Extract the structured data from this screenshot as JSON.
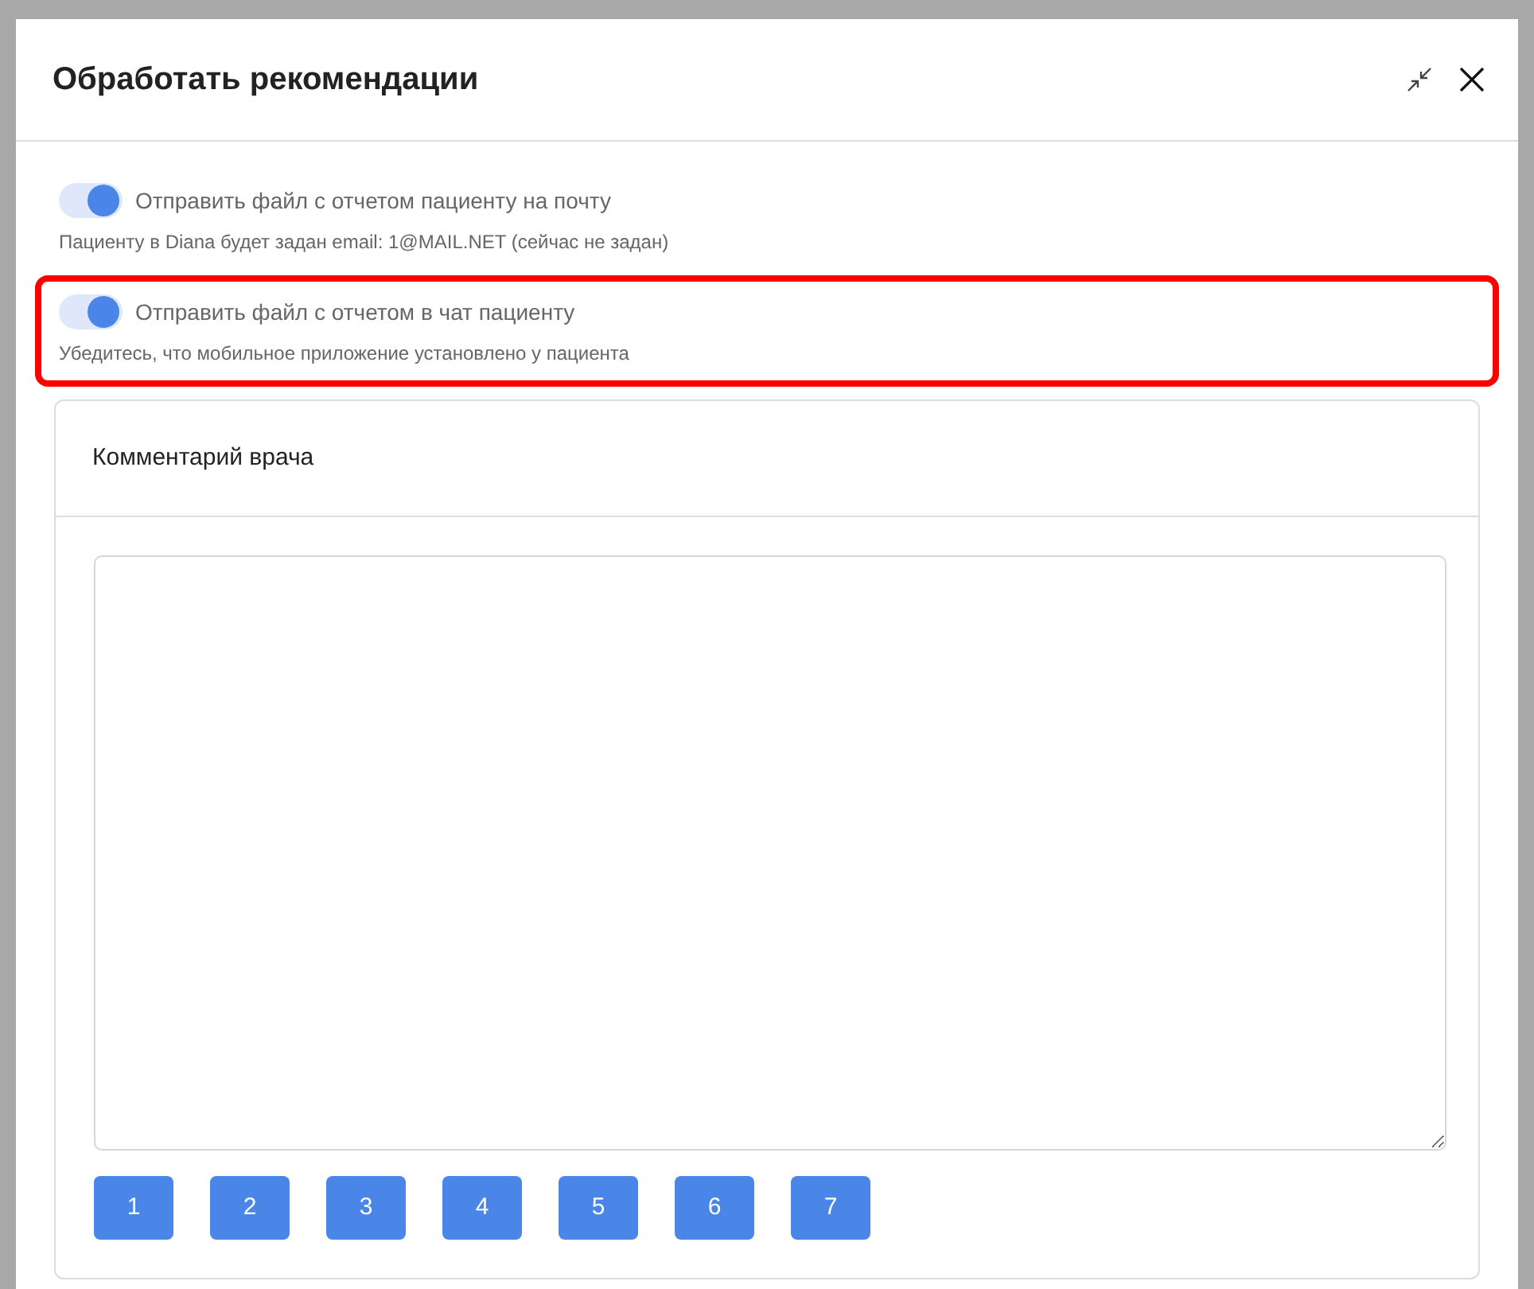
{
  "dialog": {
    "title": "Обработать рекомендации"
  },
  "options": [
    {
      "label": "Отправить файл с отчетом пациенту на почту",
      "hint": "Пациенту в Diana будет задан email: 1@MAIL.NET (сейчас не задан)",
      "on": true,
      "highlighted": false
    },
    {
      "label": "Отправить файл с отчетом в чат пациенту",
      "hint": "Убедитесь, что мобильное приложение установлено у пациента",
      "on": true,
      "highlighted": true
    }
  ],
  "comment_card": {
    "title": "Комментарий врача",
    "buttons": [
      "1",
      "2",
      "3",
      "4",
      "5",
      "6",
      "7"
    ]
  }
}
